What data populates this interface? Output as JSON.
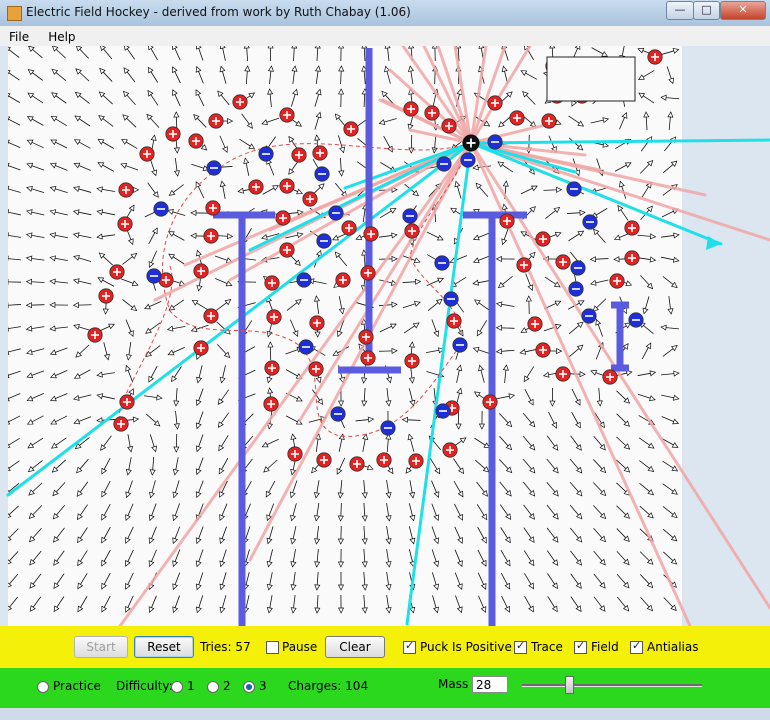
{
  "window": {
    "title": "Electric Field Hockey - derived from work by Ruth Chabay (1.06)",
    "minimize_glyph": "—",
    "maximize_glyph": "□",
    "close_glyph": "✕"
  },
  "menu": {
    "items": [
      {
        "label": "File"
      },
      {
        "label": "Help"
      }
    ]
  },
  "controls": {
    "start_label": "Start",
    "reset_label": "Reset",
    "tries_text": "Tries: 57",
    "pause_label": "Pause",
    "pause_checked": false,
    "clear_label": "Clear",
    "puck_positive_label": "Puck Is Positive",
    "puck_positive_checked": true,
    "trace_label": "Trace",
    "trace_checked": true,
    "field_label": "Field",
    "field_checked": true,
    "antialias_label": "Antialias",
    "antialias_checked": true
  },
  "settings": {
    "practice_label": "Practice",
    "difficulty_label": "Difficulty:",
    "difficulty_options": [
      "1",
      "2",
      "3"
    ],
    "difficulty_selected": "3",
    "charges_text": "Charges: 104",
    "mass_label": "Mass",
    "mass_value": "28",
    "mass_slider_fraction": 0.26
  },
  "colors": {
    "positive_charge": "#e62121",
    "negative_charge": "#1f2fd8",
    "wall": "#5b5be0",
    "cyan_field": "#1fe0e8",
    "pink_field": "#f2a6a6",
    "trace": "#e04a4a",
    "puck": "#111111",
    "yellow_panel": "#f4f00a",
    "green_panel": "#2bd81e"
  },
  "icons": {
    "app_icon": "hockey-app-icon",
    "positive_symbol": "+",
    "negative_symbol": "−",
    "puck_symbol": "+"
  }
}
